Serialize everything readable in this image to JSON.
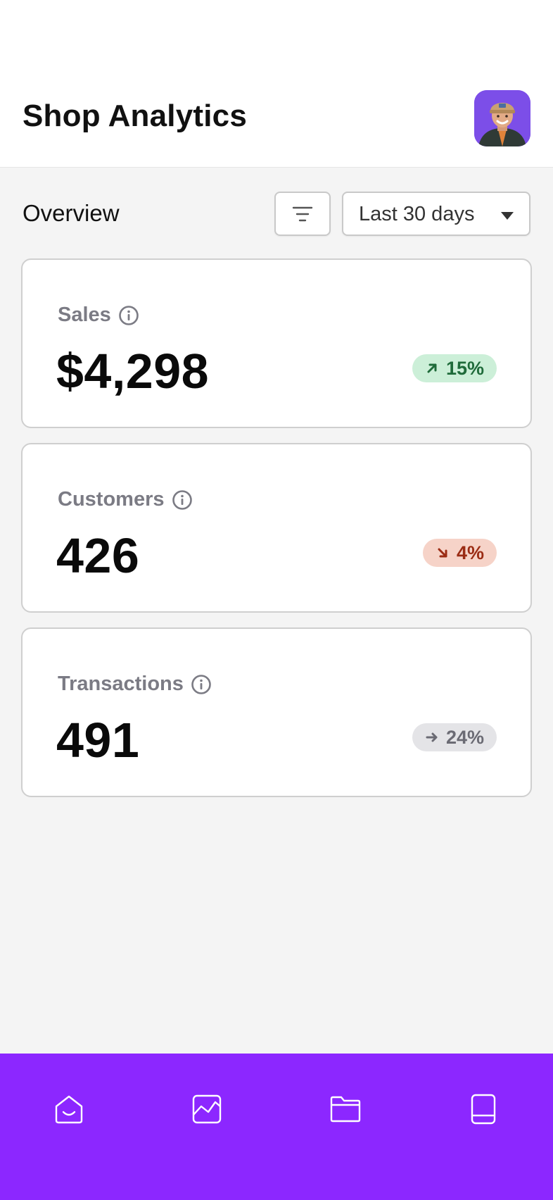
{
  "header": {
    "title": "Shop Analytics",
    "avatar_icon": "user-avatar-photo"
  },
  "toolbar": {
    "label": "Overview",
    "filter_icon": "filter-icon",
    "range": {
      "selected": "Last 30 days"
    }
  },
  "metrics": [
    {
      "label": "Sales",
      "value": "$4,298",
      "change": "15%",
      "trend": "up",
      "trend_icon": "arrow-up-right-icon",
      "color": "#1f6b3a"
    },
    {
      "label": "Customers",
      "value": "426",
      "change": "4%",
      "trend": "down",
      "trend_icon": "arrow-down-right-icon",
      "color": "#9b2c14"
    },
    {
      "label": "Transactions",
      "value": "491",
      "change": "24%",
      "trend": "flat",
      "trend_icon": "arrow-right-icon",
      "color": "#6b6b74"
    }
  ],
  "bottom_nav": {
    "items": [
      {
        "icon": "home-icon"
      },
      {
        "icon": "analytics-icon"
      },
      {
        "icon": "folder-icon"
      },
      {
        "icon": "book-icon"
      }
    ],
    "background": "#8c27ff"
  }
}
